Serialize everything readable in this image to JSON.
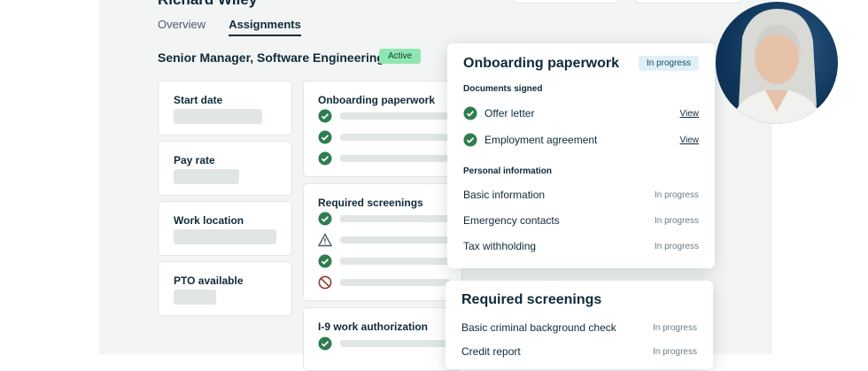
{
  "header": {
    "person_name": "Richard Wiley",
    "tabs": [
      {
        "label": "Overview",
        "active": false
      },
      {
        "label": "Assignments",
        "active": true
      }
    ]
  },
  "assignment": {
    "job_title": "Senior Manager, Software Engineering",
    "status_badge": "Active"
  },
  "info_cards": [
    {
      "label": "Start date"
    },
    {
      "label": "Pay rate"
    },
    {
      "label": "Work location"
    },
    {
      "label": "PTO available"
    }
  ],
  "section_cards": [
    {
      "label": "Onboarding paperwork",
      "rows": [
        "check",
        "check",
        "check"
      ]
    },
    {
      "label": "Required screenings",
      "rows": [
        "check",
        "warning",
        "check",
        "blocked"
      ]
    },
    {
      "label": "I-9 work authorization",
      "rows": [
        "check"
      ]
    }
  ],
  "onboarding_popover": {
    "title": "Onboarding paperwork",
    "status": "In progress",
    "documents_heading": "Documents signed",
    "documents": [
      {
        "name": "Offer letter",
        "action": "View"
      },
      {
        "name": "Employment agreement",
        "action": "View"
      }
    ],
    "personal_heading": "Personal information",
    "personal_items": [
      {
        "name": "Basic information",
        "status": "In progress"
      },
      {
        "name": "Emergency contacts",
        "status": "In progress"
      },
      {
        "name": "Tax withholding",
        "status": "In progress"
      }
    ]
  },
  "screenings_popover": {
    "title": "Required screenings",
    "items": [
      {
        "name": "Basic criminal background check",
        "status": "In progress"
      },
      {
        "name": "Credit report",
        "status": "In progress"
      }
    ]
  },
  "colors": {
    "accent_green": "#2e7d4f",
    "active_badge_bg": "#8fe6b2",
    "in_progress_pill_bg": "#dff1f7",
    "text_dark": "#0f2a3a"
  },
  "icons": {
    "check": "check-circle-icon",
    "warning": "warning-triangle-icon",
    "blocked": "blocked-circle-icon"
  }
}
